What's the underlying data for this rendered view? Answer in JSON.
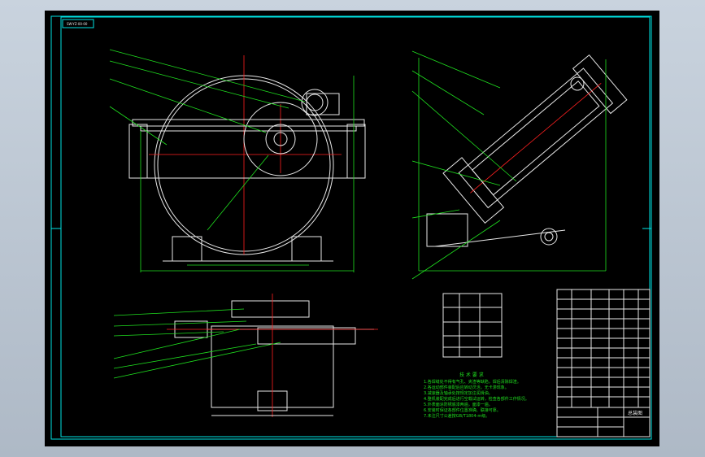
{
  "drawing": {
    "title_tag": "SW-YZ-00-00",
    "notes_heading": "技 术 要 求",
    "notes_lines": [
      "1.各焊缝处不得有气孔、夹渣等缺陷，焊后清除焊渣。",
      "2.各运动部件装配后应转动灵活，无卡滞现象。",
      "3.减速器及轴承处按规定加注润滑油。",
      "4.整机装配完成后进行空载试运转，检查各部件工作情况。",
      "5.外表面涂防锈底漆两遍，面漆一遍。",
      "6.安装时保证各部件位置准确、联接可靠。",
      "7.未注尺寸公差按GB/T1804-m级。"
    ],
    "titleblock_label": "总装图",
    "colors": {
      "frame": "#00e5e5",
      "annotation": "#1fe01f",
      "geometry": "#e8e8e8",
      "centerline": "#ff2020"
    }
  }
}
